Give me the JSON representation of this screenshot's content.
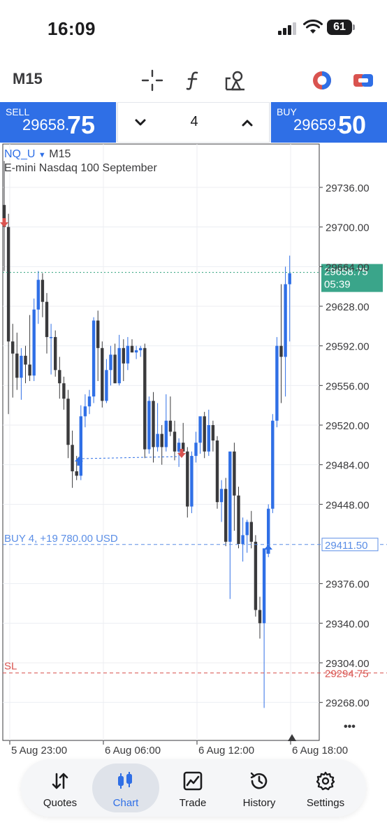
{
  "status_bar": {
    "time": "16:09",
    "battery": "61"
  },
  "toolbar": {
    "timeframe": "M15",
    "icons": [
      "crosshair-icon",
      "function-icon",
      "objects-icon",
      "account-switch-icon",
      "trade-toggle-icon"
    ]
  },
  "trade_panel": {
    "sell_label": "SELL",
    "sell_price_main": "29658.",
    "sell_price_big": "75",
    "buy_label": "BUY",
    "buy_price_main": "29659.",
    "buy_price_big": "50",
    "volume": "4"
  },
  "chart": {
    "symbol": "NQ_U",
    "symbol_timeframe": "M15",
    "description": "E-mini Nasdaq 100 September",
    "price_axis_labels": [
      "29736.00",
      "29700.00",
      "29664.00",
      "29628.00",
      "29592.00",
      "29556.00",
      "29520.00",
      "29484.00",
      "29448.00",
      "29376.00",
      "29340.00",
      "29304.00",
      "29268.00"
    ],
    "current_price": "29658.75",
    "countdown": "05:39",
    "position_label": "BUY 4, +19 780.00 USD",
    "position_price": "29411.50",
    "sl_label": "SL",
    "sl_price": "29294.75",
    "time_labels": [
      "5 Aug 23:00",
      "6 Aug 06:00",
      "6 Aug 12:00",
      "6 Aug 18:00"
    ],
    "more": "•••",
    "colors": {
      "bull": "#2f6fe6",
      "bear": "#3a3a3c",
      "bid_line": "#2aa07a",
      "position_line": "#5b8ee6",
      "sl_line": "#d9534f"
    }
  },
  "chart_data": {
    "type": "candlestick",
    "title": "NQ_U M15",
    "ylim": [
      29250,
      29770
    ],
    "candles": [
      {
        "o": 29720,
        "h": 29760,
        "l": 29660,
        "c": 29700
      },
      {
        "o": 29700,
        "h": 29712,
        "l": 29530,
        "c": 29596
      },
      {
        "o": 29596,
        "h": 29612,
        "l": 29545,
        "c": 29585
      },
      {
        "o": 29585,
        "h": 29604,
        "l": 29552,
        "c": 29563
      },
      {
        "o": 29563,
        "h": 29590,
        "l": 29543,
        "c": 29583
      },
      {
        "o": 29583,
        "h": 29592,
        "l": 29558,
        "c": 29575
      },
      {
        "o": 29575,
        "h": 29620,
        "l": 29560,
        "c": 29565
      },
      {
        "o": 29565,
        "h": 29635,
        "l": 29560,
        "c": 29625
      },
      {
        "o": 29625,
        "h": 29660,
        "l": 29612,
        "c": 29652
      },
      {
        "o": 29652,
        "h": 29658,
        "l": 29618,
        "c": 29632
      },
      {
        "o": 29632,
        "h": 29640,
        "l": 29585,
        "c": 29600
      },
      {
        "o": 29600,
        "h": 29612,
        "l": 29566,
        "c": 29600
      },
      {
        "o": 29600,
        "h": 29606,
        "l": 29564,
        "c": 29570
      },
      {
        "o": 29570,
        "h": 29582,
        "l": 29544,
        "c": 29558
      },
      {
        "o": 29558,
        "h": 29564,
        "l": 29534,
        "c": 29544
      },
      {
        "o": 29544,
        "h": 29552,
        "l": 29490,
        "c": 29502
      },
      {
        "o": 29502,
        "h": 29515,
        "l": 29463,
        "c": 29478
      },
      {
        "o": 29478,
        "h": 29492,
        "l": 29470,
        "c": 29474
      },
      {
        "o": 29474,
        "h": 29538,
        "l": 29470,
        "c": 29528
      },
      {
        "o": 29528,
        "h": 29548,
        "l": 29518,
        "c": 29537
      },
      {
        "o": 29537,
        "h": 29552,
        "l": 29530,
        "c": 29546
      },
      {
        "o": 29546,
        "h": 29618,
        "l": 29540,
        "c": 29615
      },
      {
        "o": 29615,
        "h": 29624,
        "l": 29560,
        "c": 29590
      },
      {
        "o": 29590,
        "h": 29596,
        "l": 29536,
        "c": 29542
      },
      {
        "o": 29542,
        "h": 29580,
        "l": 29540,
        "c": 29570
      },
      {
        "o": 29570,
        "h": 29592,
        "l": 29556,
        "c": 29584
      },
      {
        "o": 29584,
        "h": 29594,
        "l": 29558,
        "c": 29558
      },
      {
        "o": 29558,
        "h": 29602,
        "l": 29556,
        "c": 29590
      },
      {
        "o": 29590,
        "h": 29598,
        "l": 29560,
        "c": 29576
      },
      {
        "o": 29576,
        "h": 29600,
        "l": 29570,
        "c": 29592
      },
      {
        "o": 29592,
        "h": 29598,
        "l": 29586,
        "c": 29586
      },
      {
        "o": 29586,
        "h": 29592,
        "l": 29580,
        "c": 29588
      },
      {
        "o": 29588,
        "h": 29592,
        "l": 29582,
        "c": 29590
      },
      {
        "o": 29590,
        "h": 29594,
        "l": 29490,
        "c": 29498
      },
      {
        "o": 29498,
        "h": 29546,
        "l": 29494,
        "c": 29542
      },
      {
        "o": 29542,
        "h": 29550,
        "l": 29486,
        "c": 29500
      },
      {
        "o": 29500,
        "h": 29540,
        "l": 29496,
        "c": 29512
      },
      {
        "o": 29512,
        "h": 29520,
        "l": 29484,
        "c": 29500
      },
      {
        "o": 29500,
        "h": 29548,
        "l": 29496,
        "c": 29524
      },
      {
        "o": 29524,
        "h": 29546,
        "l": 29510,
        "c": 29514
      },
      {
        "o": 29514,
        "h": 29524,
        "l": 29488,
        "c": 29496
      },
      {
        "o": 29496,
        "h": 29508,
        "l": 29482,
        "c": 29504
      },
      {
        "o": 29504,
        "h": 29522,
        "l": 29500,
        "c": 29496
      },
      {
        "o": 29496,
        "h": 29500,
        "l": 29436,
        "c": 29446
      },
      {
        "o": 29446,
        "h": 29496,
        "l": 29440,
        "c": 29492
      },
      {
        "o": 29492,
        "h": 29514,
        "l": 29486,
        "c": 29504
      },
      {
        "o": 29504,
        "h": 29520,
        "l": 29494,
        "c": 29528
      },
      {
        "o": 29528,
        "h": 29532,
        "l": 29490,
        "c": 29496
      },
      {
        "o": 29496,
        "h": 29534,
        "l": 29492,
        "c": 29520
      },
      {
        "o": 29520,
        "h": 29524,
        "l": 29496,
        "c": 29506
      },
      {
        "o": 29506,
        "h": 29510,
        "l": 29444,
        "c": 29450
      },
      {
        "o": 29450,
        "h": 29470,
        "l": 29432,
        "c": 29462
      },
      {
        "o": 29462,
        "h": 29472,
        "l": 29410,
        "c": 29414
      },
      {
        "o": 29414,
        "h": 29440,
        "l": 29362,
        "c": 29496
      },
      {
        "o": 29496,
        "h": 29504,
        "l": 29424,
        "c": 29456
      },
      {
        "o": 29456,
        "h": 29464,
        "l": 29408,
        "c": 29412
      },
      {
        "o": 29412,
        "h": 29436,
        "l": 29396,
        "c": 29420
      },
      {
        "o": 29420,
        "h": 29434,
        "l": 29404,
        "c": 29432
      },
      {
        "o": 29432,
        "h": 29442,
        "l": 29408,
        "c": 29414
      },
      {
        "o": 29414,
        "h": 29420,
        "l": 29346,
        "c": 29352
      },
      {
        "o": 29352,
        "h": 29364,
        "l": 29326,
        "c": 29340
      },
      {
        "o": 29340,
        "h": 29352,
        "l": 29263,
        "c": 29408
      },
      {
        "o": 29408,
        "h": 29448,
        "l": 29400,
        "c": 29444
      },
      {
        "o": 29444,
        "h": 29530,
        "l": 29440,
        "c": 29524
      },
      {
        "o": 29524,
        "h": 29600,
        "l": 29518,
        "c": 29592
      },
      {
        "o": 29592,
        "h": 29648,
        "l": 29540,
        "c": 29582
      },
      {
        "o": 29582,
        "h": 29664,
        "l": 29546,
        "c": 29648
      },
      {
        "o": 29648,
        "h": 29674,
        "l": 29596,
        "c": 29658
      }
    ],
    "position_entry": 29411.5,
    "stop_loss": 29294.75,
    "bid": 29658.75
  },
  "bottom_nav": [
    {
      "label": "Quotes",
      "icon": "quotes-arrows-icon"
    },
    {
      "label": "Chart",
      "icon": "candles-icon"
    },
    {
      "label": "Trade",
      "icon": "trade-chart-icon"
    },
    {
      "label": "History",
      "icon": "history-clock-icon"
    },
    {
      "label": "Settings",
      "icon": "gear-icon"
    }
  ]
}
